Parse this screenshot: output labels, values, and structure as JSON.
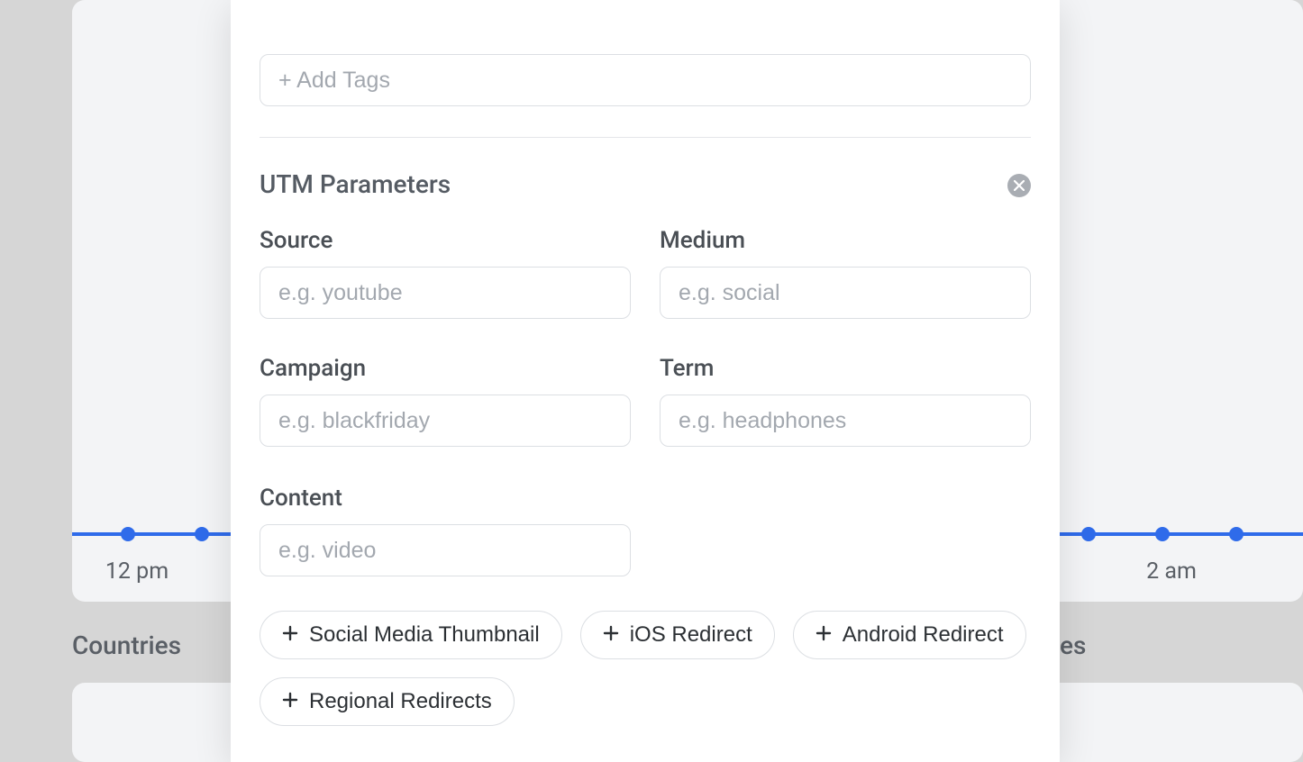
{
  "background": {
    "axis_labels": [
      "12 pm",
      "2 am"
    ],
    "section_left": "Countries",
    "section_right_partial": "es"
  },
  "modal": {
    "tags_placeholder": "+ Add Tags",
    "section_title": "UTM Parameters",
    "fields": {
      "source": {
        "label": "Source",
        "placeholder": "e.g. youtube"
      },
      "medium": {
        "label": "Medium",
        "placeholder": "e.g. social"
      },
      "campaign": {
        "label": "Campaign",
        "placeholder": "e.g. blackfriday"
      },
      "term": {
        "label": "Term",
        "placeholder": "e.g. headphones"
      },
      "content": {
        "label": "Content",
        "placeholder": "e.g. video"
      }
    },
    "chips": [
      "Social Media Thumbnail",
      "iOS Redirect",
      "Android Redirect",
      "Regional Redirects"
    ]
  }
}
